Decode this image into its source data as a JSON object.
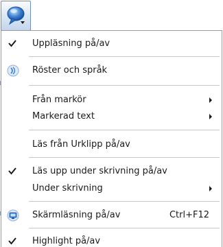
{
  "toolbar": {
    "speech_button_icon": "speech-bubble-icon"
  },
  "menu": {
    "items": [
      {
        "label": "Uppläsning på/av",
        "checked": true
      },
      {
        "label": "Röster och språk",
        "icon": "voice-icon"
      },
      {
        "label": "Från markör",
        "submenu": true
      },
      {
        "label": "Markerad text",
        "submenu": true
      },
      {
        "label": "Läs från Urklipp på/av"
      },
      {
        "label": "Läs upp under skrivning på/av",
        "checked": true
      },
      {
        "label": "Under skrivning",
        "submenu": true
      },
      {
        "label": "Skärmläsning på/av",
        "icon": "screen-reader-icon",
        "shortcut": "Ctrl+F12"
      },
      {
        "label": "Highlight på/av",
        "checked": true
      }
    ]
  },
  "colors": {
    "menu_border": "#9a9a9a",
    "separator": "#c8c8c8",
    "button_border": "#6f8fb6",
    "icon_blue": "#3b7fd1"
  }
}
